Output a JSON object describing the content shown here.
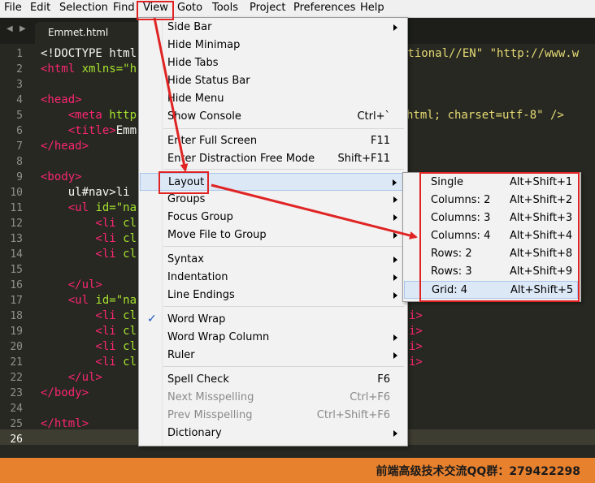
{
  "menubar": {
    "items": [
      {
        "label": "File"
      },
      {
        "label": "Edit"
      },
      {
        "label": "Selection"
      },
      {
        "label": "Find"
      },
      {
        "label": "View"
      },
      {
        "label": "Goto"
      },
      {
        "label": "Tools"
      },
      {
        "label": "Project"
      },
      {
        "label": "Preferences"
      },
      {
        "label": "Help"
      }
    ]
  },
  "tabbar": {
    "back_icon": "◀",
    "forward_icon": "▶",
    "tab": {
      "label": "Emmet.html"
    }
  },
  "editor": {
    "active_line": 26,
    "line_numbers": [
      "1",
      "2",
      "3",
      "4",
      "5",
      "6",
      "7",
      "8",
      "9",
      "10",
      "11",
      "12",
      "13",
      "14",
      "15",
      "16",
      "17",
      "18",
      "19",
      "20",
      "21",
      "22",
      "23",
      "24",
      "25",
      "26"
    ],
    "lines": {
      "l1": {
        "a": "<!DOCTYPE html",
        "b": "itional//EN\" \"http://www.w"
      },
      "l2": {
        "a": "<html",
        "b": " xmlns=\"h"
      },
      "l4": {
        "a": "<head>"
      },
      "l5": {
        "a": "    <meta",
        "b": " http",
        "c": "html; charset=utf-8\" />"
      },
      "l6": {
        "a": "    <title>",
        "b": "Emm"
      },
      "l7": {
        "a": "</head>"
      },
      "l9": {
        "a": "<body>"
      },
      "l10": {
        "a": "    ul#nav>li"
      },
      "l11": {
        "a": "    <ul",
        "b": " id=\"na"
      },
      "l12": {
        "a": "        <li",
        "b": " cl"
      },
      "l13": {
        "a": "        <li",
        "b": " cl"
      },
      "l14": {
        "a": "        <li",
        "b": " cl"
      },
      "l16": {
        "a": "    </ul>"
      },
      "l17": {
        "a": "    <ul",
        "b": " id=\"na"
      },
      "l18": {
        "a": "        <li",
        "b": " cl",
        "c": "i>"
      },
      "l19": {
        "a": "        <li",
        "b": " cl",
        "c": "i>"
      },
      "l20": {
        "a": "        <li",
        "b": " cl",
        "c": "i>"
      },
      "l21": {
        "a": "        <li",
        "b": " cl",
        "c": "i>"
      },
      "l22": {
        "a": "    </ul>"
      },
      "l23": {
        "a": "</body>"
      },
      "l25": {
        "a": "</html>"
      }
    }
  },
  "view_menu": {
    "items": [
      {
        "label": "Side Bar",
        "shortcut": "",
        "submenu": true
      },
      {
        "label": "Hide Minimap",
        "shortcut": ""
      },
      {
        "label": "Hide Tabs",
        "shortcut": ""
      },
      {
        "label": "Hide Status Bar",
        "shortcut": ""
      },
      {
        "label": "Hide Menu",
        "shortcut": ""
      },
      {
        "label": "Show Console",
        "shortcut": "Ctrl+`"
      },
      {
        "label": "Enter Full Screen",
        "shortcut": "F11"
      },
      {
        "label": "Enter Distraction Free Mode",
        "shortcut": "Shift+F11"
      },
      {
        "label": "Layout",
        "shortcut": "",
        "submenu": true
      },
      {
        "label": "Groups",
        "shortcut": "",
        "submenu": true
      },
      {
        "label": "Focus Group",
        "shortcut": "",
        "submenu": true
      },
      {
        "label": "Move File to Group",
        "shortcut": "",
        "submenu": true
      },
      {
        "label": "Syntax",
        "shortcut": "",
        "submenu": true
      },
      {
        "label": "Indentation",
        "shortcut": "",
        "submenu": true
      },
      {
        "label": "Line Endings",
        "shortcut": "",
        "submenu": true
      },
      {
        "label": "Word Wrap",
        "shortcut": "",
        "checked": true
      },
      {
        "label": "Word Wrap Column",
        "shortcut": "",
        "submenu": true
      },
      {
        "label": "Ruler",
        "shortcut": "",
        "submenu": true
      },
      {
        "label": "Spell Check",
        "shortcut": "F6"
      },
      {
        "label": "Next Misspelling",
        "shortcut": "Ctrl+F6",
        "disabled": true
      },
      {
        "label": "Prev Misspelling",
        "shortcut": "Ctrl+Shift+F6",
        "disabled": true
      },
      {
        "label": "Dictionary",
        "shortcut": "",
        "submenu": true
      }
    ],
    "check_icon": "✓"
  },
  "layout_submenu": {
    "items": [
      {
        "label": "Single",
        "shortcut": "Alt+Shift+1"
      },
      {
        "label": "Columns: 2",
        "shortcut": "Alt+Shift+2"
      },
      {
        "label": "Columns: 3",
        "shortcut": "Alt+Shift+3"
      },
      {
        "label": "Columns: 4",
        "shortcut": "Alt+Shift+4"
      },
      {
        "label": "Rows: 2",
        "shortcut": "Alt+Shift+8"
      },
      {
        "label": "Rows: 3",
        "shortcut": "Alt+Shift+9"
      },
      {
        "label": "Grid: 4",
        "shortcut": "Alt+Shift+5"
      }
    ]
  },
  "statusbar": {
    "watermark": "前端高级技术交流QQ群：279422298"
  },
  "colors": {
    "editor_bg": "#272822",
    "tag": "#f92672",
    "attr": "#a6e22e",
    "string": "#e6db74",
    "annotation": "#e02424",
    "statusbar": "#e8812e"
  }
}
